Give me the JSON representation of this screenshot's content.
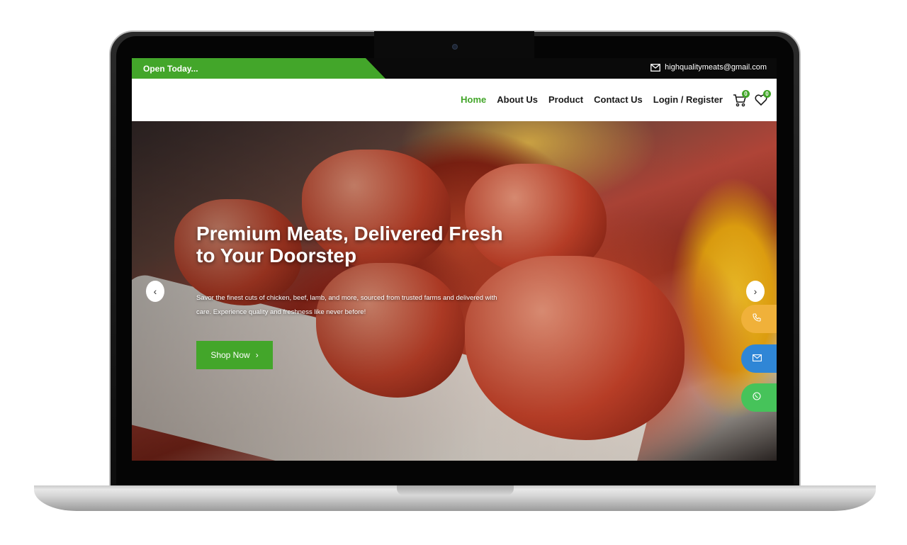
{
  "topbar": {
    "status_text": "Open Today...",
    "email": "highqualitymeats@gmail.com",
    "email_icon": "mail-icon"
  },
  "nav": {
    "links": [
      {
        "label": "Home",
        "active": true
      },
      {
        "label": "About Us",
        "active": false
      },
      {
        "label": "Product",
        "active": false
      },
      {
        "label": "Contact Us",
        "active": false
      },
      {
        "label": "Login / Register",
        "active": false
      }
    ],
    "cart_icon": "cart-icon",
    "cart_count": "0",
    "wishlist_icon": "heart-icon",
    "wishlist_count": "0"
  },
  "hero": {
    "title": "Premium Meats, Delivered Fresh to Your Doorstep",
    "description": "Savor the finest cuts of chicken, beef, lamb, and more, sourced from trusted farms and delivered with care. Experience quality and freshness like never before!",
    "cta_label": "Shop Now",
    "cta_icon": "chevron-right-icon",
    "prev_icon": "chevron-left-icon",
    "next_icon": "chevron-right-icon"
  },
  "floating_contacts": [
    {
      "icon": "phone-icon",
      "color": "#f0b13a"
    },
    {
      "icon": "mail-icon",
      "color": "#2f86d6"
    },
    {
      "icon": "whatsapp-icon",
      "color": "#46c35a"
    }
  ],
  "colors": {
    "brand_green": "#43a62a",
    "topbar_black": "#0a0a0a"
  }
}
